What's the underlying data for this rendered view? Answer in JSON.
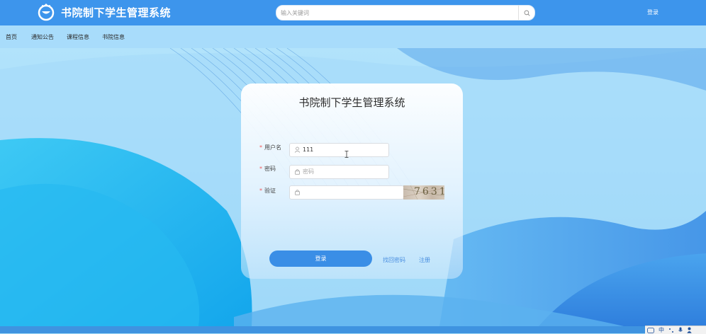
{
  "header": {
    "app_title": "书院制下学生管理系统",
    "search_placeholder": "输入关键词",
    "login_label": "登录",
    "logo_icon": "logo-icon",
    "search_icon": "search-icon"
  },
  "nav": {
    "items": [
      {
        "label": "首页"
      },
      {
        "label": "通知公告"
      },
      {
        "label": "课程信息"
      },
      {
        "label": "书院信息"
      }
    ]
  },
  "login_card": {
    "title": "书院制下学生管理系统",
    "username": {
      "label": "用户名",
      "value": "111",
      "icon": "user-icon"
    },
    "password": {
      "label": "密码",
      "placeholder": "密码",
      "value": "",
      "icon": "lock-icon"
    },
    "captcha": {
      "label": "验证",
      "value": "",
      "icon": "lock-icon",
      "image_text": "7631"
    },
    "required_mark": "*",
    "submit_label": "登录",
    "forgot_link": "找回密码",
    "register_link": "注册"
  },
  "taskbar": {
    "ime_mode": "中",
    "icons": [
      "keyboard-icon",
      "punctuation-icon",
      "mic-icon",
      "user-icon"
    ]
  },
  "colors": {
    "header_bg": "#3d95ec",
    "nav_bg": "#a8dcfb",
    "primary_button": "#3a8ee6",
    "link": "#4a8fe0",
    "required": "#f25a5a"
  }
}
